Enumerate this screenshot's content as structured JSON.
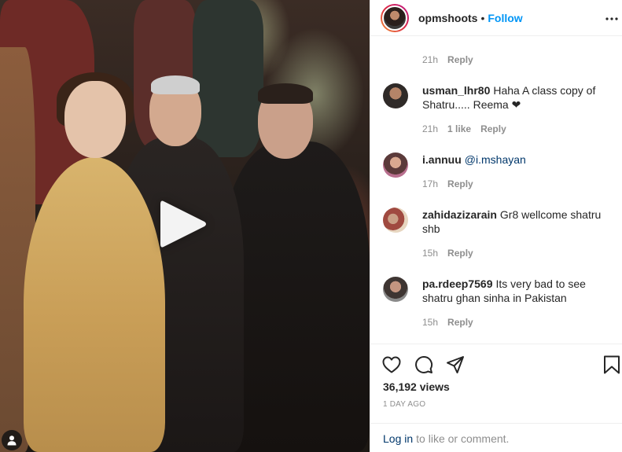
{
  "post": {
    "username": "opmshoots",
    "separator": "•",
    "follow_label": "Follow",
    "more_icon": "more-horizontal-icon"
  },
  "media": {
    "type": "video",
    "play_icon": "play-icon",
    "user_tag_icon": "user-tag-icon"
  },
  "comments": {
    "top_meta": {
      "time": "21h",
      "reply": "Reply"
    },
    "items": [
      {
        "username": "usman_lhr80",
        "text": "Haha A class copy of Shatru..... Reema ❤",
        "time": "21h",
        "likes": "1 like",
        "reply": "Reply"
      },
      {
        "username": "i.annuu",
        "mention": "@i.mshayan",
        "text": "",
        "time": "17h",
        "reply": "Reply"
      },
      {
        "username": "zahidazizarain",
        "text": "Gr8 wellcome shatru shb",
        "time": "15h",
        "reply": "Reply"
      },
      {
        "username": "pa.rdeep7569",
        "text": "Its very bad to see shatru ghan sinha in Pakistan",
        "time": "15h",
        "reply": "Reply"
      }
    ]
  },
  "actions": {
    "like_icon": "heart-icon",
    "comment_icon": "comment-icon",
    "share_icon": "share-icon",
    "save_icon": "bookmark-icon",
    "views": "36,192 views",
    "time_ago": "1 DAY AGO",
    "login_link": "Log in",
    "login_text": "to like or comment."
  },
  "colors": {
    "link_blue": "#0095f6",
    "text_primary": "#262626",
    "text_secondary": "#8e8e8e",
    "border": "#efefef"
  }
}
